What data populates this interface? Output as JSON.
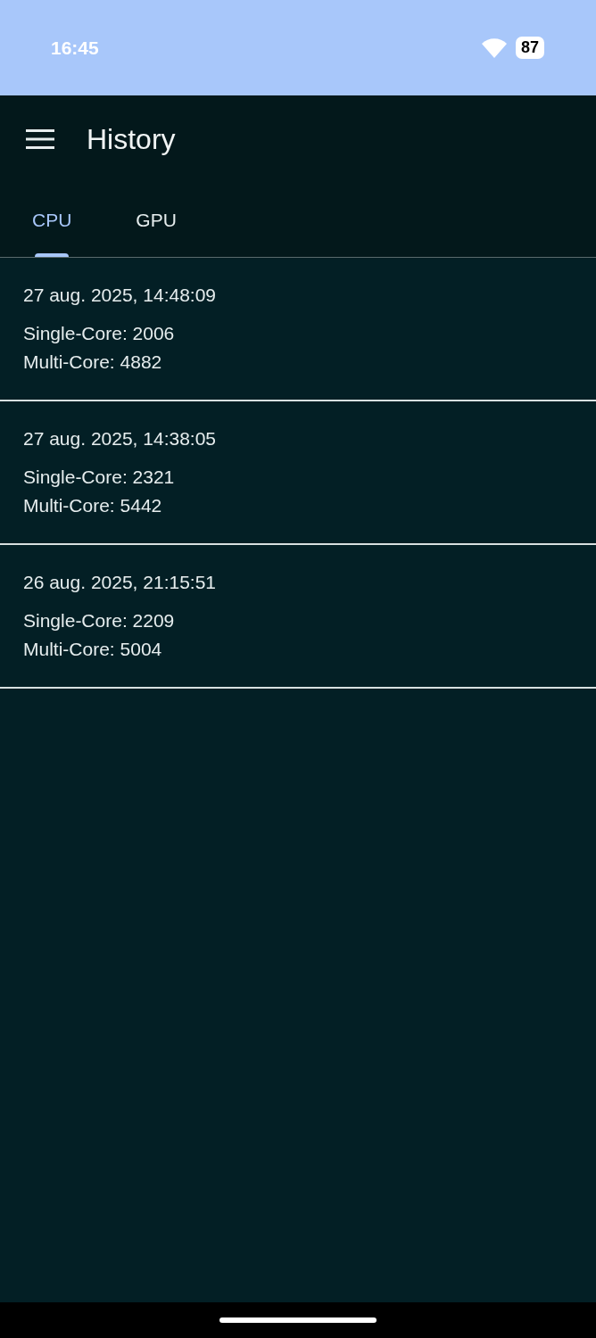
{
  "status_bar": {
    "time": "16:45",
    "battery": "87"
  },
  "app_bar": {
    "title": "History"
  },
  "tabs": [
    {
      "label": "CPU",
      "selected": true
    },
    {
      "label": "GPU",
      "selected": false
    }
  ],
  "entries": [
    {
      "date": "27 aug. 2025, 14:48:09",
      "single_core": "Single-Core: 2006",
      "multi_core": "Multi-Core: 4882"
    },
    {
      "date": "27 aug. 2025, 14:38:05",
      "single_core": "Single-Core: 2321",
      "multi_core": "Multi-Core: 5442"
    },
    {
      "date": "26 aug. 2025, 21:15:51",
      "single_core": "Single-Core: 2209",
      "multi_core": "Multi-Core: 5004"
    }
  ]
}
